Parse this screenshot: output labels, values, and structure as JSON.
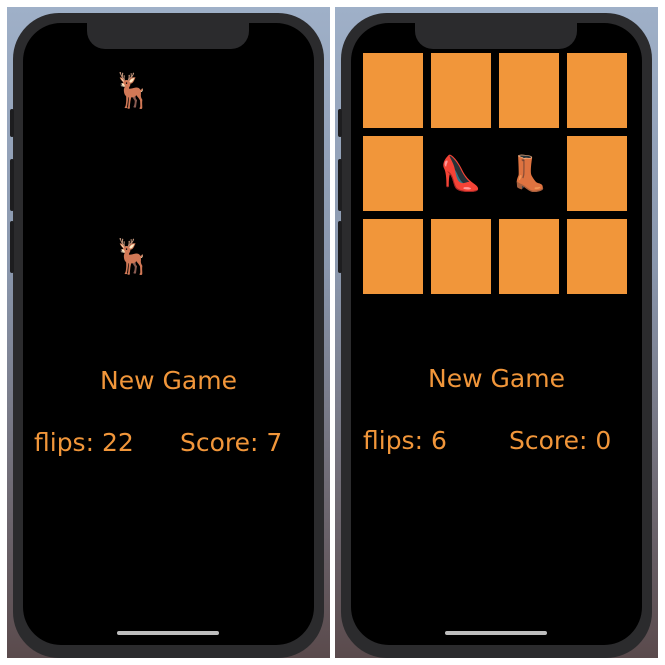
{
  "accent_color": "#f1963a",
  "screens": [
    {
      "new_game_label": "New Game",
      "flips_label": "flips: 22",
      "score_label": "Score: 7",
      "cards": [
        {
          "state": "matched",
          "emoji": ""
        },
        {
          "state": "face-up",
          "emoji": "🦌"
        },
        {
          "state": "matched",
          "emoji": ""
        },
        {
          "state": "matched",
          "emoji": ""
        },
        {
          "state": "matched",
          "emoji": ""
        },
        {
          "state": "matched",
          "emoji": ""
        },
        {
          "state": "matched",
          "emoji": ""
        },
        {
          "state": "matched",
          "emoji": ""
        },
        {
          "state": "matched",
          "emoji": ""
        },
        {
          "state": "face-up",
          "emoji": "🦌"
        },
        {
          "state": "matched",
          "emoji": ""
        },
        {
          "state": "matched",
          "emoji": ""
        }
      ]
    },
    {
      "new_game_label": "New Game",
      "flips_label": "flips: 6",
      "score_label": "Score: 0",
      "cards": [
        {
          "state": "face-down",
          "emoji": ""
        },
        {
          "state": "face-down",
          "emoji": ""
        },
        {
          "state": "face-down",
          "emoji": ""
        },
        {
          "state": "face-down",
          "emoji": ""
        },
        {
          "state": "face-down",
          "emoji": ""
        },
        {
          "state": "face-up",
          "emoji": "👠"
        },
        {
          "state": "face-up",
          "emoji": "👢"
        },
        {
          "state": "face-down",
          "emoji": ""
        },
        {
          "state": "face-down",
          "emoji": ""
        },
        {
          "state": "face-down",
          "emoji": ""
        },
        {
          "state": "face-down",
          "emoji": ""
        },
        {
          "state": "face-down",
          "emoji": ""
        }
      ]
    }
  ]
}
